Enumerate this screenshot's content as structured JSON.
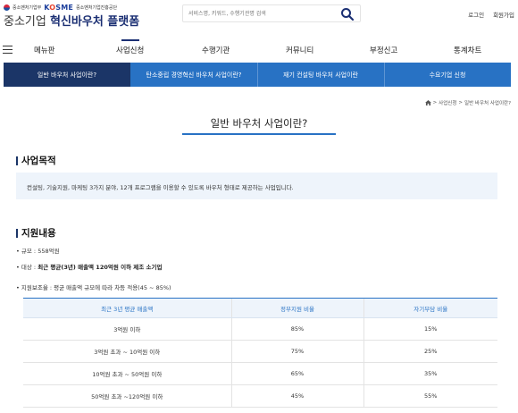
{
  "header": {
    "gov_label": "중소벤처기업부",
    "agency_brand": "KOSME",
    "agency_brand_a": "K",
    "agency_brand_b": "O",
    "agency_brand_c": "SME",
    "agency_sub": "중소벤처기업진흥공단",
    "site_title_prefix": "중소기업",
    "site_title_main": "혁신바우처 플랫폼",
    "search_placeholder": "서비스명, 키워드, 수행기관명 검색",
    "login": "로그인",
    "join": "회원가입"
  },
  "gnb": {
    "items": [
      "메뉴판",
      "사업신청",
      "수행기관",
      "커뮤니티",
      "부정신고",
      "통계차트"
    ],
    "active": "사업신청"
  },
  "subtabs": {
    "items": [
      "일반 바우처 사업이란?",
      "탄소중립 경영혁신 바우처 사업이란?",
      "재기 컨설팅 바우처 사업이란",
      "수요기업 신청"
    ],
    "active": "일반 바우처 사업이란?"
  },
  "breadcrumb": {
    "items": [
      "사업신청",
      "일반 바우처 사업이란?"
    ],
    "separator": ">"
  },
  "page_title": "일반 바우처 사업이란?",
  "purpose": {
    "title": "사업목적",
    "text": "컨설팅, 기술지원, 마케팅 3가지 분야, 12개 프로그램을 이용할 수 있도록 바우처 형태로 제공하는 사업입니다."
  },
  "support": {
    "title": "지원내용",
    "scale": "규모 : 558억원",
    "target_label": "대상 :",
    "target_value": "최근 평균(3년) 매출액 120억원 이하 제조 소기업",
    "ratio": "지원보조율 : 평균 매출액 규모에 따라 차등 적용(45 ~ 85%)",
    "table": {
      "headers": [
        "최근 3년 평균 매출액",
        "정부지원 비율",
        "자기부담 비율"
      ],
      "rows": [
        [
          "3억원 이하",
          "85%",
          "15%"
        ],
        [
          "3억원 초과 ~ 10억원 이하",
          "75%",
          "25%"
        ],
        [
          "10억원 초과 ~ 50억원 이하",
          "65%",
          "35%"
        ],
        [
          "50억원 초과 ~120억원 이하",
          "45%",
          "55%"
        ]
      ]
    }
  },
  "colors": {
    "brand_navy": "#1b2f73",
    "tab_blue": "#2872c4",
    "tab_active": "#1b3567",
    "light_bg": "#eef4fb"
  },
  "icons": {
    "search": "search-icon",
    "home": "home-icon",
    "menu": "hamburger-menu-icon"
  }
}
